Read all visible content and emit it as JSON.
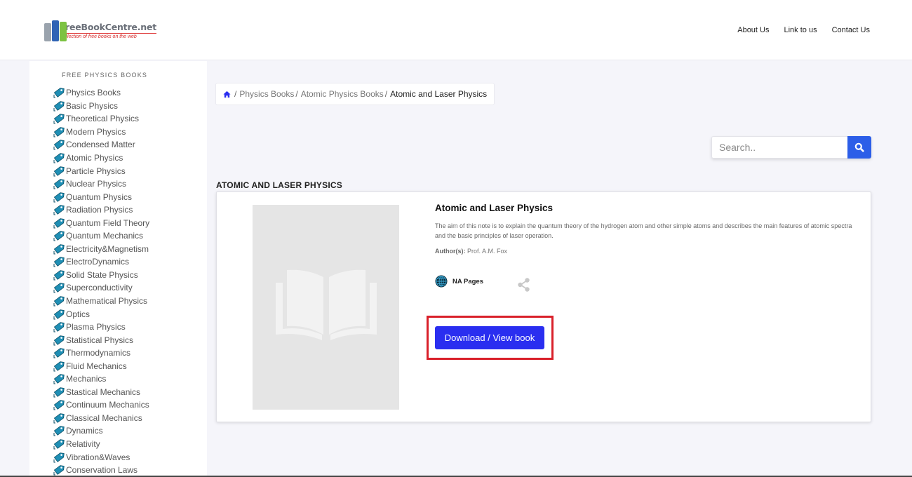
{
  "header": {
    "logo_title": "FreeBookCentre.net",
    "logo_subtitle": "Collection of free books on the web",
    "nav": [
      "About Us",
      "Link to us",
      "Contact Us"
    ]
  },
  "sidebar": {
    "title": "FREE PHYSICS BOOKS",
    "icon": "tag-icon",
    "items": [
      "Physics Books",
      "Basic Physics",
      "Theoretical Physics",
      "Modern Physics",
      "Condensed Matter",
      "Atomic Physics",
      "Particle Physics",
      "Nuclear Physics",
      "Quantum Physics",
      "Radiation Physics",
      "Quantum Field Theory",
      "Quantum Mechanics",
      "Electricity&Magnetism",
      "ElectroDynamics",
      "Solid State Physics",
      "Superconductivity",
      "Mathematical Physics",
      "Optics",
      "Plasma Physics",
      "Statistical Physics",
      "Thermodynamics",
      "Fluid Mechanics",
      "Mechanics",
      "Stastical Mechanics",
      "Continuum Mechanics",
      "Classical Mechanics",
      "Dynamics",
      "Relativity",
      "Vibration&Waves",
      "Conservation Laws"
    ]
  },
  "breadcrumb": {
    "home_icon": "home-icon",
    "items": [
      "Physics Books",
      "Atomic Physics Books"
    ],
    "current": "Atomic and Laser Physics"
  },
  "search": {
    "placeholder": "Search..",
    "value": "",
    "icon": "search-icon"
  },
  "section_title": "ATOMIC AND LASER PHYSICS",
  "book": {
    "title": "Atomic and Laser Physics",
    "description": "The aim of this note is to explain the quantum theory of the hydrogen atom and other simple atoms and describes the main features of atomic spectra and the basic principles of laser operation.",
    "author_label": "Author(s):",
    "author": "Prof. A.M. Fox",
    "pages": "NA  Pages",
    "download_label": "Download / View book"
  },
  "colors": {
    "accent": "#2a2ef0",
    "search_button": "#2c5ee8",
    "highlight": "#d9202a",
    "tag_icon": "#1f8fb5"
  }
}
